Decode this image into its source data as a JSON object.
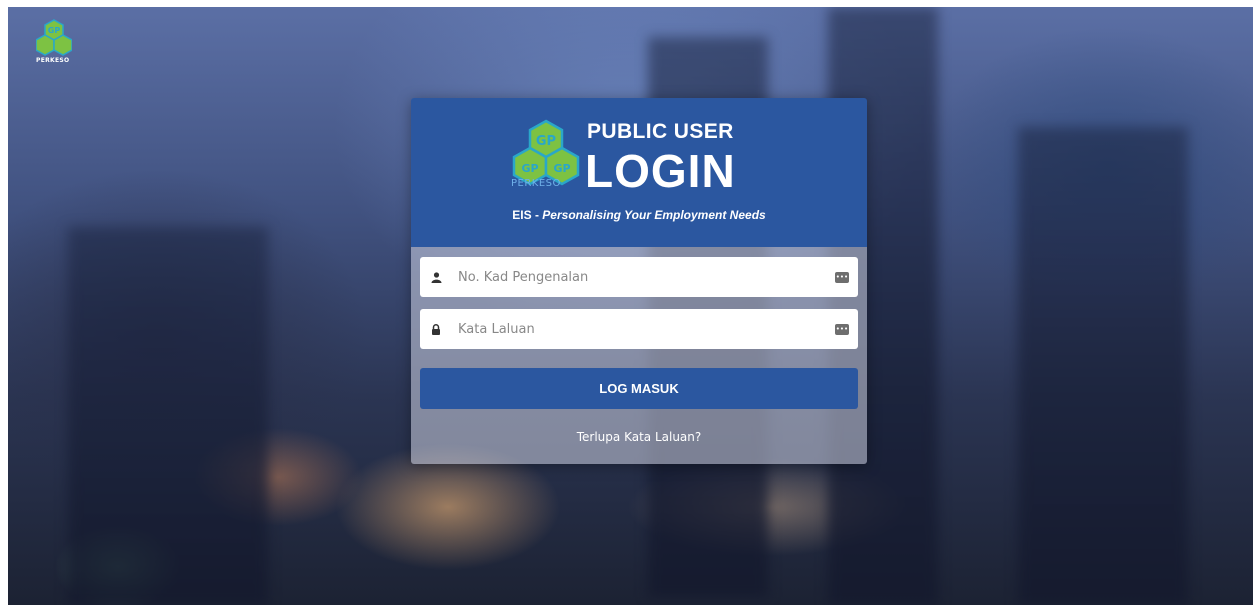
{
  "brand": {
    "corner_logo_text": "PERKESO",
    "card_logo_text": "PERKESO"
  },
  "card": {
    "title_small": "PUBLIC USER",
    "title_big": "LOGIN",
    "tagline_prefix": "EIS - ",
    "tagline_italic": "Personalising Your Employment Needs"
  },
  "form": {
    "id_placeholder": "No. Kad Pengenalan",
    "id_value": "",
    "password_placeholder": "Kata Laluan",
    "password_value": "",
    "login_label": "LOG MASUK",
    "forgot_label": "Terlupa Kata Laluan?"
  },
  "colors": {
    "brand_blue": "#2b57a0",
    "logo_green": "#7dc243",
    "logo_teal": "#2aa7c9"
  },
  "icons": {
    "user": "user-icon",
    "lock": "lock-icon",
    "keyboard": "keyboard-icon"
  }
}
